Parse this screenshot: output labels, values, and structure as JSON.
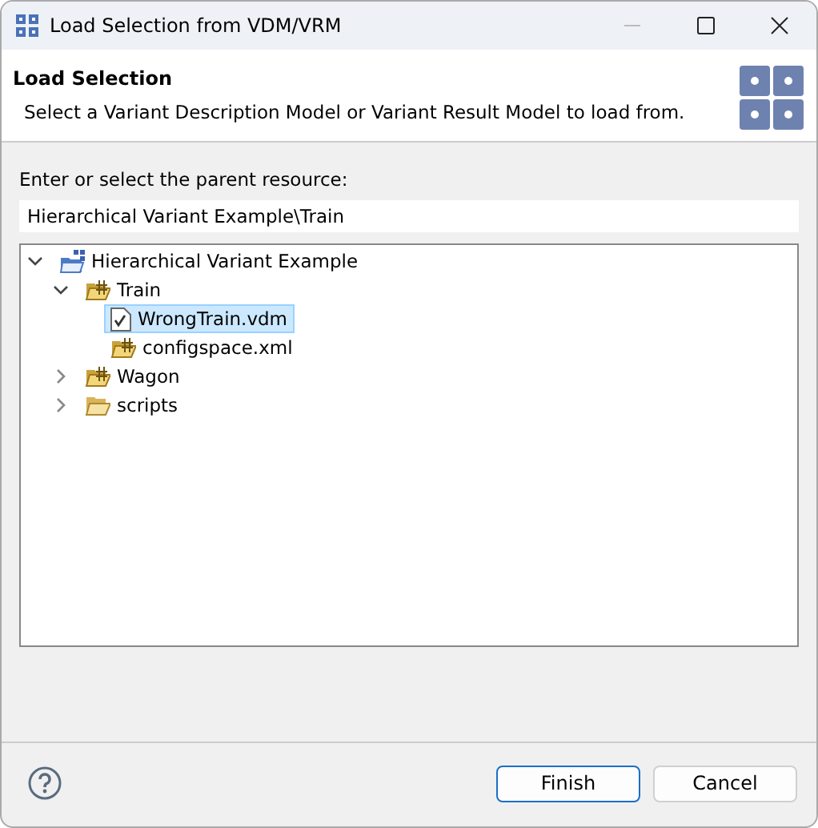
{
  "window": {
    "title": "Load Selection from VDM/VRM"
  },
  "header": {
    "title": "Load Selection",
    "description": "Select a Variant Description Model or Variant Result Model to load from."
  },
  "resource": {
    "label": "Enter or select the parent resource:",
    "value": "Hierarchical Variant Example\\Train"
  },
  "tree": [
    {
      "label": "Hierarchical Variant Example",
      "kind": "project",
      "expanded": true,
      "selected": false,
      "children": [
        {
          "label": "Train",
          "kind": "folder",
          "expanded": true,
          "selected": false,
          "children": [
            {
              "label": "WrongTrain.vdm",
              "kind": "file",
              "selected": true
            },
            {
              "label": "configspace.xml",
              "kind": "folder",
              "selected": false
            }
          ]
        },
        {
          "label": "Wagon",
          "kind": "folder",
          "expanded": false,
          "selected": false
        },
        {
          "label": "scripts",
          "kind": "plainfolder",
          "expanded": false,
          "selected": false
        }
      ]
    }
  ],
  "buttons": [
    {
      "label": "Finish",
      "kind": "default"
    },
    {
      "label": "Cancel",
      "kind": "normal"
    }
  ]
}
